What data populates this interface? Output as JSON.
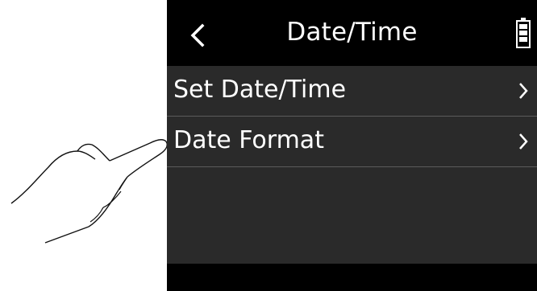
{
  "header": {
    "title": "Date/Time",
    "back_icon": "chevron-left-icon",
    "battery_icon": "battery-icon"
  },
  "menu": {
    "items": [
      {
        "label": "Set Date/Time",
        "icon": "chevron-right-icon"
      },
      {
        "label": "Date Format",
        "icon": "chevron-right-icon"
      }
    ]
  },
  "colors": {
    "screen_bg": "#000000",
    "menu_bg": "#2a2a2a",
    "divider": "#5b5b5b",
    "text": "#ffffff"
  }
}
